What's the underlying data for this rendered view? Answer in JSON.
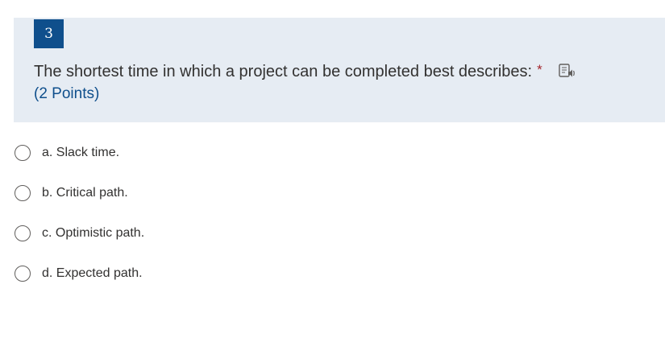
{
  "question": {
    "number": "3",
    "text": "The shortest time in which a project can be completed best describes:",
    "required_marker": "*",
    "points": "(2 Points)",
    "immersive_reader_icon": "immersive-reader-icon"
  },
  "options": [
    {
      "label": "a. Slack time.",
      "selected": false
    },
    {
      "label": "b. Critical path.",
      "selected": false
    },
    {
      "label": "c. Optimistic path.",
      "selected": false
    },
    {
      "label": "d. Expected path.",
      "selected": false
    }
  ],
  "colors": {
    "header_bg": "#e6ecf3",
    "accent": "#0f4f8c",
    "required": "#a4262c",
    "text": "#323130"
  }
}
